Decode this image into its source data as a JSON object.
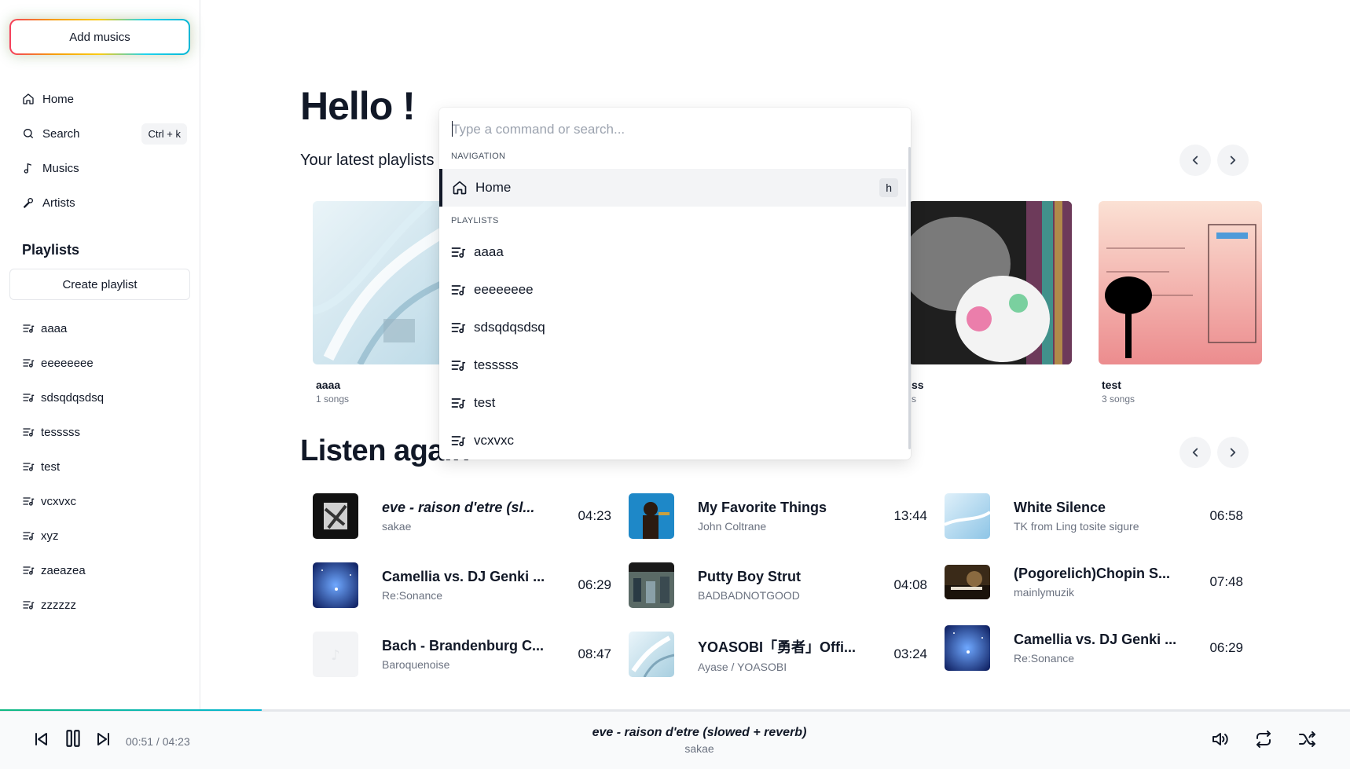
{
  "sidebar": {
    "add_musics_label": "Add musics",
    "nav": [
      {
        "label": "Home",
        "icon": "home-icon"
      },
      {
        "label": "Search",
        "icon": "search-icon",
        "shortcut": "Ctrl + k"
      },
      {
        "label": "Musics",
        "icon": "music-note-icon"
      },
      {
        "label": "Artists",
        "icon": "microphone-icon"
      }
    ],
    "playlists_title": "Playlists",
    "create_playlist_label": "Create playlist",
    "playlists": [
      "aaaa",
      "eeeeeeee",
      "sdsqdqsdsq",
      "tesssss",
      "test",
      "vcxvxc",
      "xyz",
      "zaeazea",
      "zzzzzz"
    ]
  },
  "main": {
    "greeting": "Hello !",
    "latest_playlists_label": "Your latest playlists",
    "cards": [
      {
        "name": "aaaa",
        "songs": "1 songs"
      },
      {
        "name": "ss",
        "songs": "s"
      },
      {
        "name": "test",
        "songs": "3 songs"
      }
    ],
    "listen_again_label": "Listen again",
    "tracks": [
      {
        "title": "eve - raison d'etre (sl...",
        "artist": "sakae",
        "duration": "04:23",
        "italic": true
      },
      {
        "title": "My Favorite Things",
        "artist": "John Coltrane",
        "duration": "13:44"
      },
      {
        "title": "White Silence",
        "artist": "TK from Ling tosite sigure",
        "duration": "06:58"
      },
      {
        "title": "Camellia vs. DJ Genki ...",
        "artist": "Re:Sonance",
        "duration": "06:29"
      },
      {
        "title": "Putty Boy Strut",
        "artist": "BADBADNOTGOOD",
        "duration": "04:08"
      },
      {
        "title": "(Pogorelich)Chopin S...",
        "artist": "mainlymuzik",
        "duration": "07:48"
      },
      {
        "title": "Bach - Brandenburg C...",
        "artist": "Baroquenoise",
        "duration": "08:47"
      },
      {
        "title": "YOASOBI「勇者」Offi...",
        "artist": "Ayase / YOASOBI",
        "duration": "03:24"
      },
      {
        "title": "Camellia vs. DJ Genki ...",
        "artist": "Re:Sonance",
        "duration": "06:29"
      }
    ]
  },
  "command_palette": {
    "placeholder": "Type a command or search...",
    "navigation_group": "NAVIGATION",
    "nav_item": {
      "label": "Home",
      "shortcut": "h"
    },
    "playlists_group": "PLAYLISTS",
    "playlists": [
      "aaaa",
      "eeeeeeee",
      "sdsqdqsdsq",
      "tesssss",
      "test",
      "vcxvxc"
    ]
  },
  "player": {
    "time": "00:51 / 04:23",
    "progress": 0.194,
    "now_playing_title": "eve - raison d'etre (slowed + reverb)",
    "now_playing_artist": "sakae"
  },
  "colors": {
    "accent_progress_start": "#10b981",
    "accent_progress_end": "#06b6d4",
    "add_button_gradient": [
      "#f43f5e",
      "#f59e0b",
      "#facc15",
      "#22d3ee",
      "#06b6d4"
    ]
  }
}
